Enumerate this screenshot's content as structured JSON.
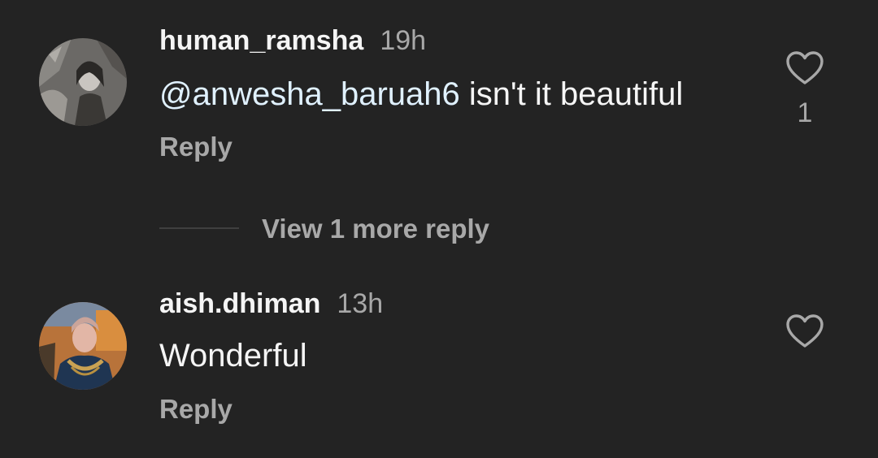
{
  "comments": [
    {
      "username": "human_ramsha",
      "time": "19h",
      "mention": "@anwesha_baruah6",
      "text": " isn't it beautiful",
      "reply_label": "Reply",
      "like_count": "1",
      "like_icon": "heart-outline-icon"
    },
    {
      "username": "aish.dhiman",
      "time": "13h",
      "text": "Wonderful",
      "reply_label": "Reply",
      "like_icon": "heart-outline-icon"
    }
  ],
  "view_more": {
    "label": "View 1 more reply"
  },
  "colors": {
    "background": "#232323",
    "primary_text": "#f5f5f5",
    "secondary_text": "#a8a8a8",
    "mention": "#e0f1ff"
  }
}
